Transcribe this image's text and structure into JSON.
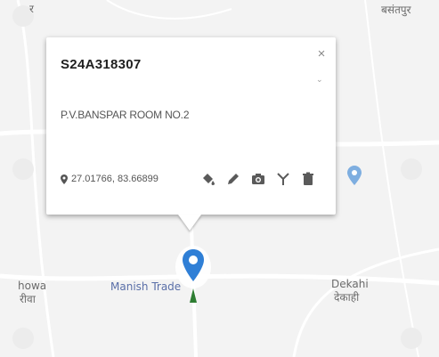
{
  "popup": {
    "title": "S24A318307",
    "address": "P.V.BANSPAR ROOM NO.2",
    "coordinates": "27.01766, 83.66899",
    "close_glyph": "×",
    "scroll_glyph": "⌄",
    "tools": [
      {
        "icon": "paint-bucket-icon"
      },
      {
        "icon": "pencil-icon"
      },
      {
        "icon": "camera-icon"
      },
      {
        "icon": "antenna-icon"
      },
      {
        "icon": "trash-icon"
      }
    ]
  },
  "map": {
    "labels": {
      "top_left": "र",
      "top_right": "बसंतपुर",
      "left": "howa",
      "left_hindi": "रीवा",
      "place": "Manish Trade",
      "dekahi": "Dekahi",
      "dekahi_hindi": "देकाही"
    },
    "colors": {
      "pin_blue": "#2f7fd6",
      "pin_green": "#2e7d32",
      "map_bg": "#f2f2f2",
      "road": "#ffffff",
      "secondary_pin": "#5b9bd5"
    }
  }
}
